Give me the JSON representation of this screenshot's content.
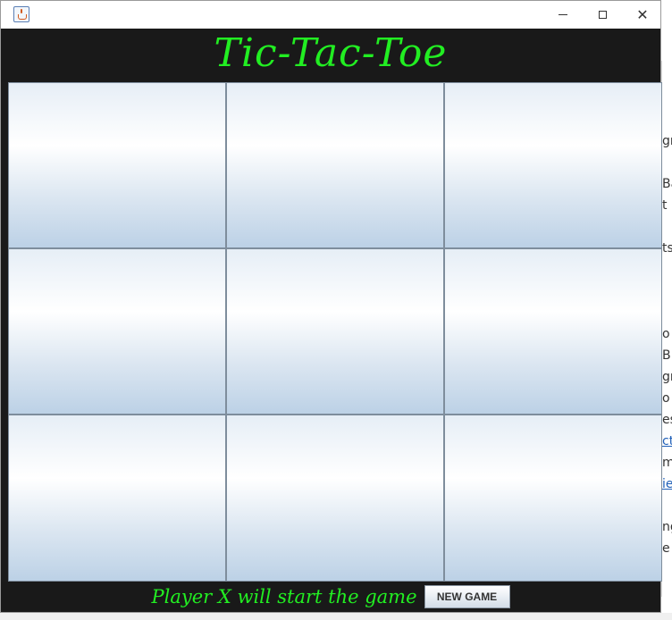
{
  "window": {
    "title": "",
    "app_icon": "java-cup-icon",
    "controls": {
      "minimize_icon": "minimize-icon",
      "maximize_icon": "maximize-icon",
      "close_glyph": "✕"
    }
  },
  "header": {
    "title": "Tic-Tac-Toe"
  },
  "board": {
    "cells": [
      "",
      "",
      "",
      "",
      "",
      "",
      "",
      "",
      ""
    ]
  },
  "footer": {
    "status": "Player X will start the game",
    "new_game_label": "NEW GAME"
  },
  "background_app": {
    "fragments": [
      "gr",
      "Ba",
      "t",
      "ts",
      "o",
      "B",
      "gr",
      "o",
      "es",
      "ct",
      "m",
      "ie",
      "ng",
      "e"
    ]
  },
  "colors": {
    "accent_text": "#22ee22",
    "dark_panel": "#191919",
    "cell_gradient_top": "#e6eef6",
    "cell_gradient_bottom": "#bcd1e6"
  }
}
